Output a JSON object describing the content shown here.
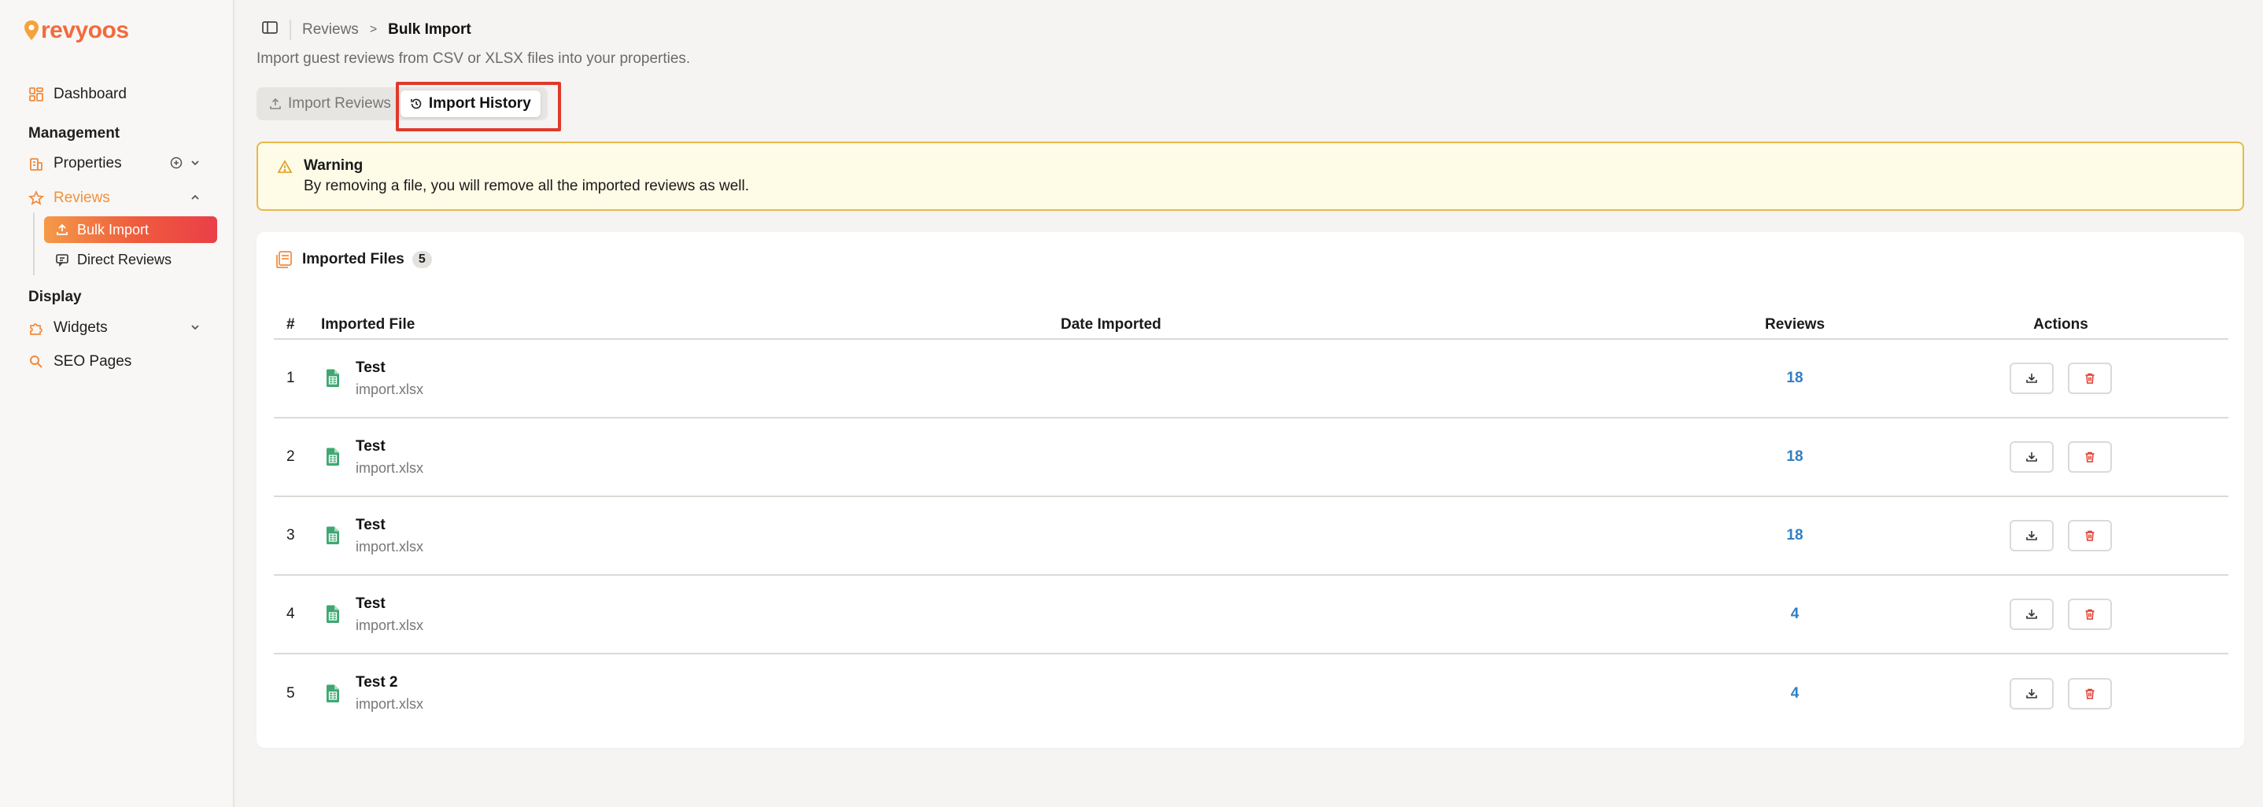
{
  "sidebar": {
    "brand": "revyoos",
    "dashboard": "Dashboard",
    "section_management": "Management",
    "properties": "Properties",
    "reviews": "Reviews",
    "bulk_import": "Bulk Import",
    "direct_reviews": "Direct Reviews",
    "section_display": "Display",
    "widgets": "Widgets",
    "seo_pages": "SEO Pages"
  },
  "breadcrumb": {
    "parent": "Reviews",
    "separator": ">",
    "current": "Bulk Import"
  },
  "page": {
    "subtitle": "Import guest reviews from CSV or XLSX files into your properties."
  },
  "tabs": {
    "import_reviews": "Import Reviews",
    "import_history": "Import History"
  },
  "warning": {
    "title": "Warning",
    "text": "By removing a file, you will remove all the imported reviews as well."
  },
  "card": {
    "title": "Imported Files",
    "count": "5"
  },
  "table": {
    "headers": {
      "num": "#",
      "file": "Imported File",
      "date": "Date Imported",
      "reviews": "Reviews",
      "actions": "Actions"
    },
    "rows": [
      {
        "num": "1",
        "name": "Test",
        "file": "import.xlsx",
        "date": "",
        "reviews": "18"
      },
      {
        "num": "2",
        "name": "Test",
        "file": "import.xlsx",
        "date": "",
        "reviews": "18"
      },
      {
        "num": "3",
        "name": "Test",
        "file": "import.xlsx",
        "date": "",
        "reviews": "18"
      },
      {
        "num": "4",
        "name": "Test",
        "file": "import.xlsx",
        "date": "",
        "reviews": "4"
      },
      {
        "num": "5",
        "name": "Test 2",
        "file": "import.xlsx",
        "date": "",
        "reviews": "4"
      }
    ]
  },
  "colors": {
    "accent": "#f26a3d",
    "active_gradient_start": "#f49a48",
    "active_gradient_end": "#ea3f48",
    "link": "#2f7fc4",
    "warning_border": "#e8b94a",
    "warning_bg": "#fefbe7",
    "delete": "#e0392b",
    "file_icon": "#3fa872",
    "highlight": "#e0392b"
  }
}
